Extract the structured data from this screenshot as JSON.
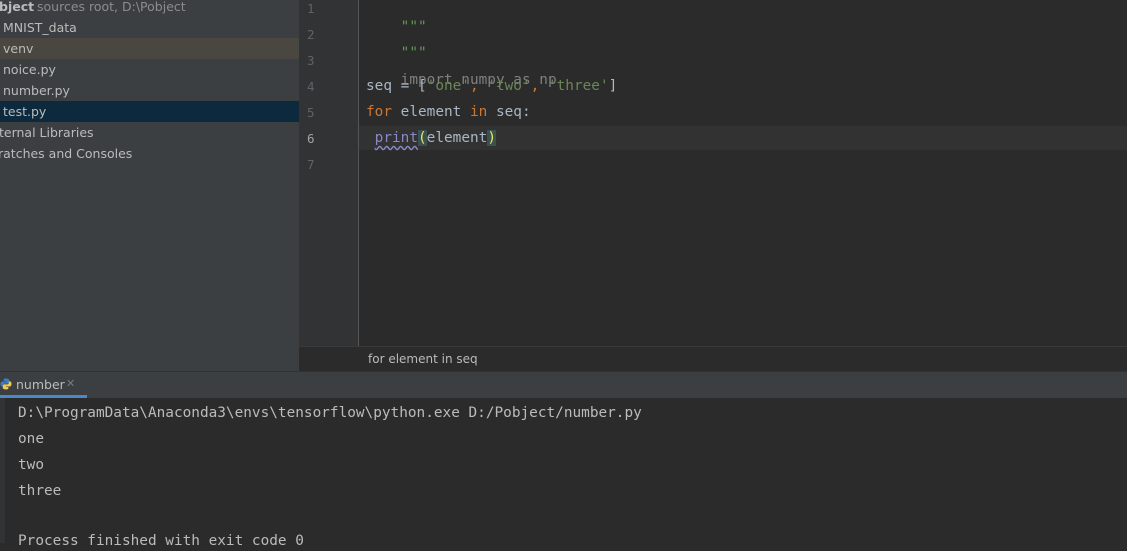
{
  "project": {
    "root_name": "bject",
    "root_hint": "sources root,  D:\\Pobject",
    "items": [
      {
        "label": "MNIST_data"
      },
      {
        "label": "venv"
      },
      {
        "label": "noice.py"
      },
      {
        "label": "number.py"
      },
      {
        "label": "test.py"
      },
      {
        "label": "ternal Libraries"
      },
      {
        "label": "ratches and Consoles"
      }
    ]
  },
  "editor": {
    "line_numbers": [
      "1",
      "2",
      "3",
      "4",
      "5",
      "6",
      "7"
    ],
    "active_line": "6",
    "lines": {
      "l1": "\"\"\"",
      "l2": "\"\"\"",
      "l3": "import numpy as np",
      "l4_pre": "seq = [",
      "l4_s1": "'one'",
      "l4_c1": ", ",
      "l4_s2": "'two'",
      "l4_c2": ", ",
      "l4_s3": "'three'",
      "l4_post": "]",
      "l5_kw1": "for",
      "l5_mid": " element ",
      "l5_kw2": "in",
      "l5_post": " seq:",
      "l6_indent": " ",
      "l6_builtin": "print",
      "l6_open": "(",
      "l6_arg": "element",
      "l6_close": ")"
    },
    "breadcrumb": "for element in seq"
  },
  "run": {
    "tab_label": "number",
    "console_lines": [
      "D:\\ProgramData\\Anaconda3\\envs\\tensorflow\\python.exe D:/Pobject/number.py",
      "one",
      "two",
      "three",
      "",
      "Process finished with exit code 0"
    ]
  },
  "colors": {
    "background": "#2b2b2b",
    "panel": "#3c3f41",
    "selection": "#0d293e",
    "keyword": "#cc7832",
    "string": "#6a8759",
    "accent": "#4a88c7"
  }
}
